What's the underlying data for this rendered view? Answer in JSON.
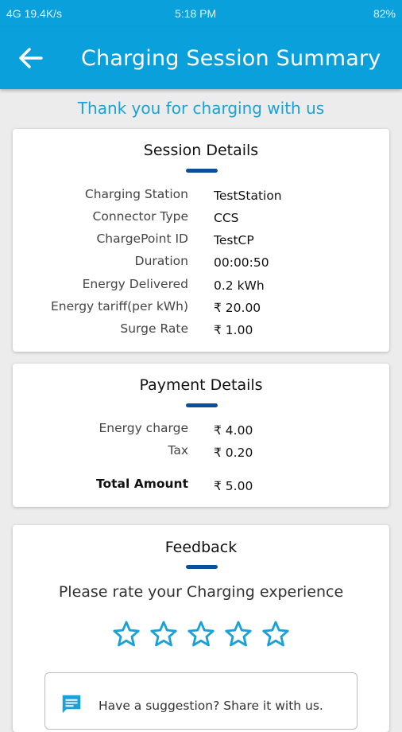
{
  "status_bar": {
    "left": "4G 19.4K/s",
    "time": "5:18 PM",
    "right": "82%"
  },
  "app_bar": {
    "title": "Charging Session Summary",
    "back_icon": "arrow-back-icon"
  },
  "thanks_message": "Thank you for charging with us",
  "session_details": {
    "title": "Session Details",
    "rows": [
      {
        "label": "Charging Station",
        "value": "TestStation"
      },
      {
        "label": "Connector Type",
        "value": "CCS"
      },
      {
        "label": "ChargePoint ID",
        "value": "TestCP"
      },
      {
        "label": "Duration",
        "value": "00:00:50"
      },
      {
        "label": "Energy Delivered",
        "value": "0.2 kWh"
      },
      {
        "label": "Energy tariff(per kWh)",
        "value": "₹ 20.00"
      },
      {
        "label": "Surge Rate",
        "value": "₹ 1.00"
      }
    ]
  },
  "payment_details": {
    "title": "Payment Details",
    "rows": [
      {
        "label": "Energy charge",
        "value": "₹ 4.00"
      },
      {
        "label": "Tax",
        "value": "₹ 0.20"
      }
    ],
    "total": {
      "label": "Total Amount",
      "value": "₹ 5.00"
    }
  },
  "feedback": {
    "title": "Feedback",
    "prompt": "Please rate your Charging experience",
    "rating": 0,
    "max_rating": 5,
    "suggestion_placeholder": "Have a suggestion? Share it with us."
  },
  "colors": {
    "primary": "#0aa0dc",
    "accent_underline": "#0b4f9c",
    "star": "#1aa1d8"
  }
}
